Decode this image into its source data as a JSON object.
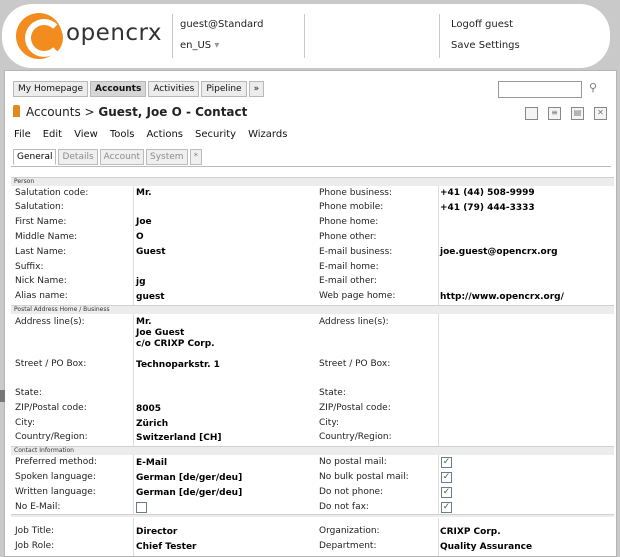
{
  "header": {
    "logo_text": "opencrx",
    "user": "guest@Standard",
    "locale": "en_US",
    "locale_arrow": "▾",
    "logoff": "Logoff guest",
    "save_settings": "Save Settings"
  },
  "top_tabs": [
    "My Homepage",
    "Accounts",
    "Activities",
    "Pipeline",
    "»"
  ],
  "search": {
    "value": ""
  },
  "title": {
    "prefix": "Accounts > ",
    "name": "Guest, Joe O - Contact"
  },
  "menu": [
    "File",
    "Edit",
    "View",
    "Tools",
    "Actions",
    "Security",
    "Wizards"
  ],
  "sub_tabs": [
    "General",
    "Details",
    "Account",
    "System",
    "*"
  ],
  "sections": {
    "person": "Person",
    "postal": "Postal Address Home / Business",
    "contact": "Contact Information"
  },
  "person_left": [
    {
      "label": "Salutation code:",
      "value": "Mr."
    },
    {
      "label": "Salutation:",
      "value": ""
    },
    {
      "label": "First Name:",
      "value": "Joe"
    },
    {
      "label": "Middle Name:",
      "value": "O"
    },
    {
      "label": "Last Name:",
      "value": "Guest"
    },
    {
      "label": "Suffix:",
      "value": ""
    },
    {
      "label": "Nick Name:",
      "value": "jg"
    },
    {
      "label": "Alias name:",
      "value": "guest"
    }
  ],
  "person_right": [
    {
      "label": "Phone business:",
      "value": "+41 (44) 508-9999"
    },
    {
      "label": "Phone mobile:",
      "value": "+41 (79) 444-3333"
    },
    {
      "label": "Phone home:",
      "value": ""
    },
    {
      "label": "Phone other:",
      "value": ""
    },
    {
      "label": "E-mail business:",
      "value": "joe.guest@opencrx.org"
    },
    {
      "label": "E-mail home:",
      "value": ""
    },
    {
      "label": "E-mail other:",
      "value": ""
    },
    {
      "label": "Web page home:",
      "value": "http://www.opencrx.org/"
    }
  ],
  "postal_left": {
    "address_label": "Address line(s):",
    "address_value": "Mr.\nJoe Guest\nc/o CRIXP Corp.",
    "street_label": "Street / PO Box:",
    "street_value": "Technoparkstr. 1",
    "state_label": "State:",
    "zip_label": "ZIP/Postal code:",
    "zip_value": "8005",
    "city_label": "City:",
    "city_value": "Zürich",
    "country_label": "Country/Region:",
    "country_value": "Switzerland [CH]"
  },
  "postal_right": {
    "address_label": "Address line(s):",
    "street_label": "Street / PO Box:",
    "state_label": "State:",
    "zip_label": "ZIP/Postal code:",
    "city_label": "City:",
    "country_label": "Country/Region:"
  },
  "contact_left": [
    {
      "label": "Preferred method:",
      "value": "E-Mail"
    },
    {
      "label": "Spoken language:",
      "value": "German [de/ger/deu]"
    },
    {
      "label": "Written language:",
      "value": "German [de/ger/deu]"
    },
    {
      "label": "No E-Mail:",
      "checked": false
    }
  ],
  "contact_right": [
    {
      "label": "No postal mail:",
      "checked": true
    },
    {
      "label": "No bulk postal mail:",
      "checked": true
    },
    {
      "label": "Do not phone:",
      "checked": true
    },
    {
      "label": "Do not fax:",
      "checked": true
    }
  ],
  "job_left": [
    {
      "label": "Job Title:",
      "value": "Director"
    },
    {
      "label": "Job Role:",
      "value": "Chief Tester"
    }
  ],
  "job_right": [
    {
      "label": "Organization:",
      "value": "CRIXP Corp."
    },
    {
      "label": "Department:",
      "value": "Quality Assurance"
    }
  ],
  "checkmark": "✓",
  "colors": {
    "accent": "#f28c1e",
    "check": "#2b6d2b"
  }
}
